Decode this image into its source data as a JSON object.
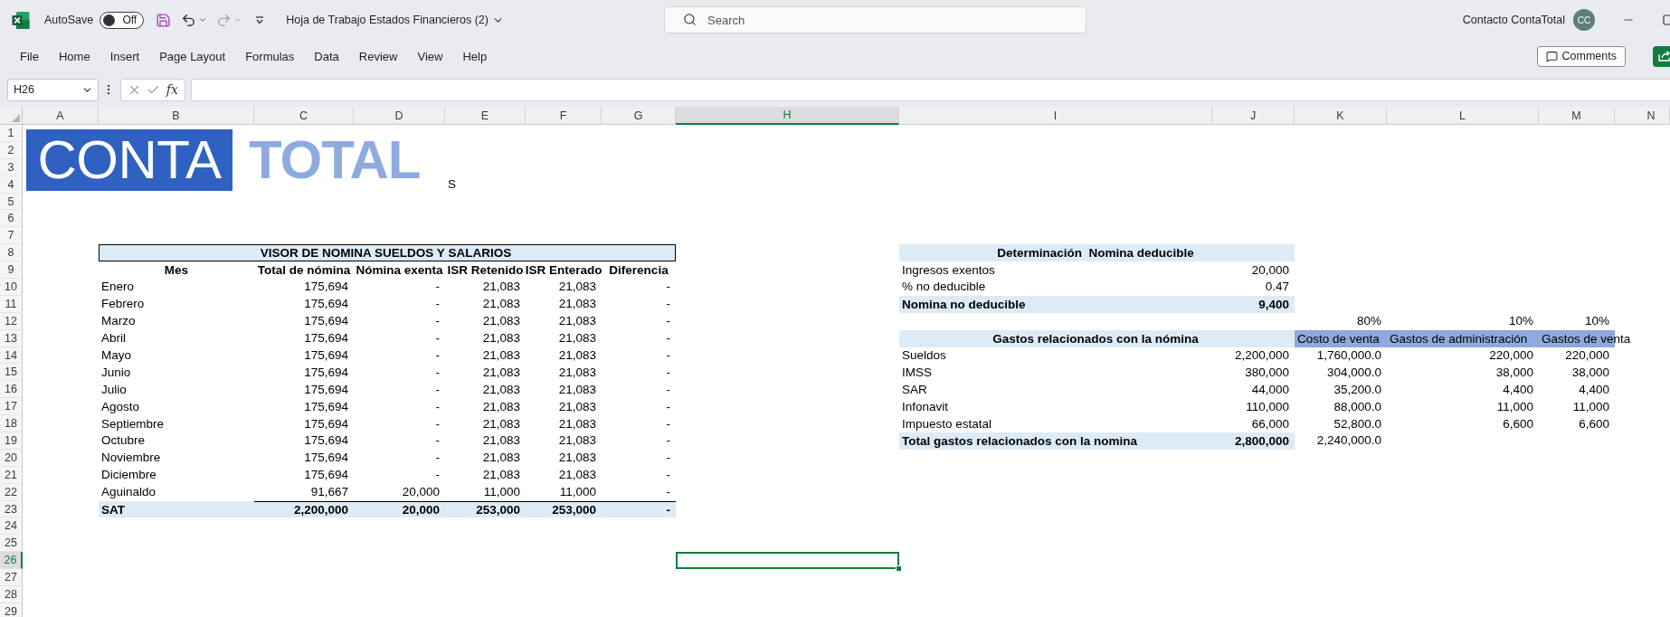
{
  "title_bar": {
    "autosave": {
      "label": "AutoSave",
      "on": false,
      "state_label": "Off"
    },
    "document_title": "Hoja de Trabajo Estados Financieros (2)",
    "search": {
      "placeholder": "Search"
    },
    "account_name": "Contacto ContaTotal",
    "avatar_initials": "CC"
  },
  "ribbon_tabs": [
    "File",
    "Home",
    "Insert",
    "Page Layout",
    "Formulas",
    "Data",
    "Review",
    "View",
    "Help"
  ],
  "comments_button": "Comments",
  "formula_bar": {
    "name_box": "H26",
    "function_label": "fx"
  },
  "sheet": {
    "columns": [
      {
        "label": "A",
        "selected": false
      },
      {
        "label": "B",
        "selected": false
      },
      {
        "label": "C",
        "selected": false
      },
      {
        "label": "D",
        "selected": false
      },
      {
        "label": "E",
        "selected": false
      },
      {
        "label": "F",
        "selected": false
      },
      {
        "label": "G",
        "selected": false
      },
      {
        "label": "H",
        "selected": true
      },
      {
        "label": "I",
        "selected": false
      },
      {
        "label": "J",
        "selected": false
      },
      {
        "label": "K",
        "selected": false
      },
      {
        "label": "L",
        "selected": false
      },
      {
        "label": "M",
        "selected": false
      },
      {
        "label": "N",
        "selected": false
      }
    ],
    "rows": [
      {
        "label": "1",
        "selected": false
      },
      {
        "label": "2",
        "selected": false
      },
      {
        "label": "3",
        "selected": false
      },
      {
        "label": "4",
        "selected": false
      },
      {
        "label": "5",
        "selected": false
      },
      {
        "label": "6",
        "selected": false
      },
      {
        "label": "7",
        "selected": false
      },
      {
        "label": "8",
        "selected": false
      },
      {
        "label": "9",
        "selected": false
      },
      {
        "label": "10",
        "selected": false
      },
      {
        "label": "11",
        "selected": false
      },
      {
        "label": "12",
        "selected": false
      },
      {
        "label": "13",
        "selected": false
      },
      {
        "label": "14",
        "selected": false
      },
      {
        "label": "15",
        "selected": false
      },
      {
        "label": "16",
        "selected": false
      },
      {
        "label": "17",
        "selected": false
      },
      {
        "label": "18",
        "selected": false
      },
      {
        "label": "19",
        "selected": false
      },
      {
        "label": "20",
        "selected": false
      },
      {
        "label": "21",
        "selected": false
      },
      {
        "label": "22",
        "selected": false
      },
      {
        "label": "23",
        "selected": false
      },
      {
        "label": "24",
        "selected": false
      },
      {
        "label": "25",
        "selected": false
      },
      {
        "label": "26",
        "selected": true
      },
      {
        "label": "27",
        "selected": false
      },
      {
        "label": "28",
        "selected": false
      },
      {
        "label": "29",
        "selected": false
      }
    ]
  },
  "logo": {
    "boxed_text": "CONTA",
    "plain_text": "TOTAL"
  },
  "cell_e4": "S",
  "payroll_table": {
    "title": "VISOR DE NOMINA SUELDOS Y SALARIOS",
    "columns": [
      "Mes",
      "Total de nómina",
      "Nómina exenta",
      "ISR Retenido",
      "ISR Enterado",
      "Diferencia"
    ],
    "rows": [
      [
        "Enero",
        "175,694",
        "-",
        "21,083",
        "21,083",
        "-"
      ],
      [
        "Febrero",
        "175,694",
        "-",
        "21,083",
        "21,083",
        "-"
      ],
      [
        "Marzo",
        "175,694",
        "-",
        "21,083",
        "21,083",
        "-"
      ],
      [
        "Abril",
        "175,694",
        "-",
        "21,083",
        "21,083",
        "-"
      ],
      [
        "Mayo",
        "175,694",
        "-",
        "21,083",
        "21,083",
        "-"
      ],
      [
        "Junio",
        "175,694",
        "-",
        "21,083",
        "21,083",
        "-"
      ],
      [
        "Julio",
        "175,694",
        "-",
        "21,083",
        "21,083",
        "-"
      ],
      [
        "Agosto",
        "175,694",
        "-",
        "21,083",
        "21,083",
        "-"
      ],
      [
        "Septiembre",
        "175,694",
        "-",
        "21,083",
        "21,083",
        "-"
      ],
      [
        "Octubre",
        "175,694",
        "-",
        "21,083",
        "21,083",
        "-"
      ],
      [
        "Noviembre",
        "175,694",
        "-",
        "21,083",
        "21,083",
        "-"
      ],
      [
        "Diciembre",
        "175,694",
        "-",
        "21,083",
        "21,083",
        "-"
      ],
      [
        "Aguinaldo",
        "91,667",
        "20,000",
        "11,000",
        "11,000",
        "-"
      ]
    ],
    "total": [
      "SAT",
      "2,200,000",
      "20,000",
      "253,000",
      "253,000",
      "-"
    ]
  },
  "deductible_table": {
    "title": "Determinación  Nomina deducible",
    "rows": [
      {
        "kind": "plain",
        "label": "Ingresos exentos",
        "value": "20,000"
      },
      {
        "kind": "plain",
        "label": "% no deducible",
        "value": "0.47"
      },
      {
        "kind": "total",
        "label": "Nomina no deducible",
        "value": "9,400"
      }
    ]
  },
  "expenses_table": {
    "percentages": [
      "80%",
      "10%",
      "10%"
    ],
    "title": "Gastos relacionados con la nómina",
    "columns": [
      "Costo de venta",
      "Gastos de administración",
      "Gastos de venta"
    ],
    "rows": [
      {
        "label": "Sueldos",
        "values": [
          "2,200,000",
          "1,760,000.0",
          "220,000",
          "220,000"
        ]
      },
      {
        "label": "IMSS",
        "values": [
          "380,000",
          "304,000.0",
          "38,000",
          "38,000"
        ]
      },
      {
        "label": "SAR",
        "values": [
          "44,000",
          "35,200.0",
          "4,400",
          "4,400"
        ]
      },
      {
        "label": "Infonavit",
        "values": [
          "110,000",
          "88,000.0",
          "11,000",
          "11,000"
        ]
      },
      {
        "label": "Impuesto estatal",
        "values": [
          "66,000",
          "52,800.0",
          "6,600",
          "6,600"
        ]
      }
    ],
    "total": {
      "label": "Total gastos relacionados con la nomina",
      "values": [
        "2,800,000",
        "2,240,000.0"
      ]
    }
  }
}
